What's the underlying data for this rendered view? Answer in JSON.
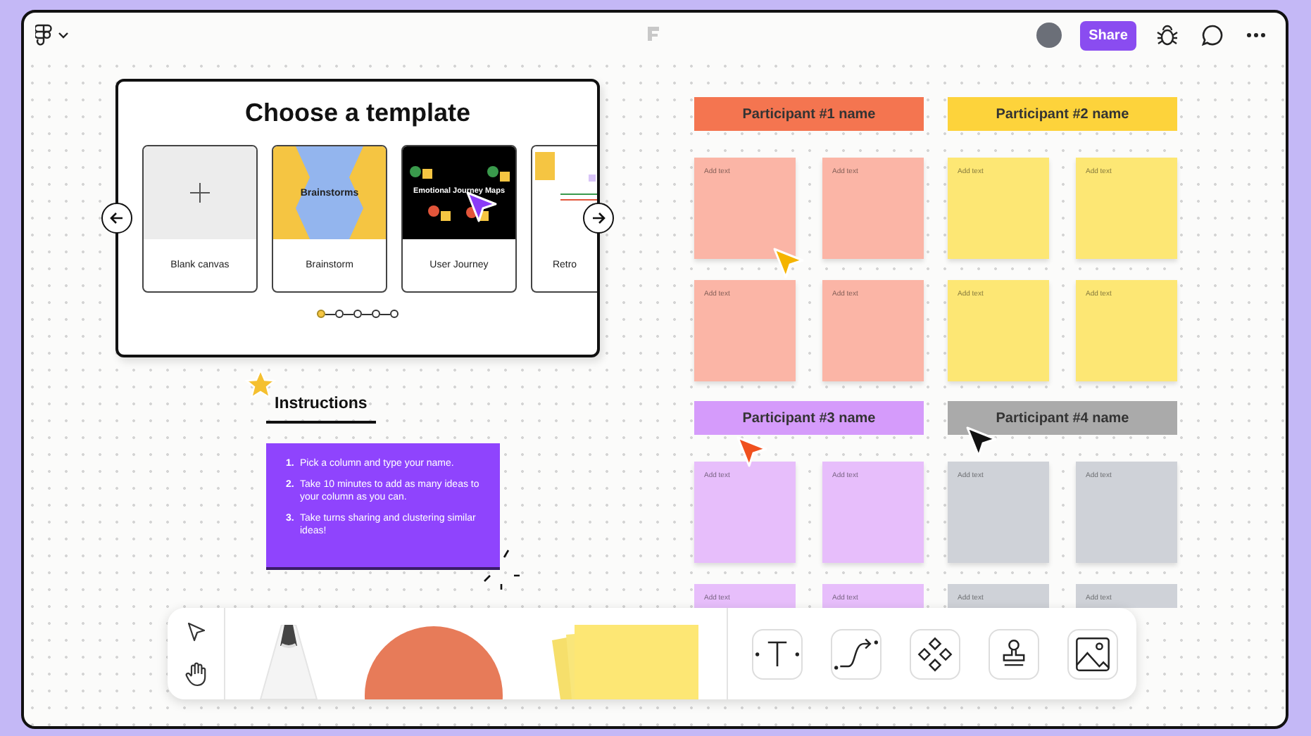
{
  "toolbar": {
    "share_label": "Share"
  },
  "template_picker": {
    "title": "Choose a template",
    "templates": [
      {
        "kind": "blank",
        "label": "Blank canvas"
      },
      {
        "kind": "brainstorm",
        "label": "Brainstorm",
        "preview_text": "Brainstorms"
      },
      {
        "kind": "journey",
        "label": "User Journey",
        "preview_text": "Emotional Journey Maps"
      },
      {
        "kind": "retro",
        "label": "Retro"
      }
    ],
    "pages": [
      {
        "selected": true
      },
      {
        "selected": false
      },
      {
        "selected": false
      },
      {
        "selected": false
      },
      {
        "selected": false
      }
    ]
  },
  "instructions": {
    "heading": "Instructions",
    "steps": [
      {
        "number": "1.",
        "text": "Pick a column and type your name."
      },
      {
        "number": "2.",
        "text": "Take 10 minutes to add as many ideas to your column as you can."
      },
      {
        "number": "3.",
        "text": "Take turns sharing and clustering similar ideas!"
      }
    ]
  },
  "participants": [
    {
      "name": "Participant #1 name",
      "color": "#f47550",
      "notes": [
        {
          "text": "Add text",
          "color": "#fbb5a6"
        },
        {
          "text": "Add text",
          "color": "#fbb5a6"
        },
        {
          "text": "Add text",
          "color": "#fbb5a6"
        },
        {
          "text": "Add text",
          "color": "#fbb5a6"
        }
      ]
    },
    {
      "name": "Participant #2 name",
      "color": "#fdd33b",
      "notes": [
        {
          "text": "Add text",
          "color": "#fde774"
        },
        {
          "text": "Add text",
          "color": "#fde774"
        },
        {
          "text": "Add text",
          "color": "#fde774"
        },
        {
          "text": "Add text",
          "color": "#fde774"
        }
      ]
    },
    {
      "name": "Participant #3 name",
      "color": "#d59bfb",
      "notes": [
        {
          "text": "Add text",
          "color": "#e7befb"
        },
        {
          "text": "Add text",
          "color": "#e7befb"
        },
        {
          "text": "Add text",
          "color": "#e7befb"
        },
        {
          "text": "Add text",
          "color": "#e7befb"
        }
      ]
    },
    {
      "name": "Participant #4 name",
      "color": "#aaaaaa",
      "notes": [
        {
          "text": "Add text",
          "color": "#cfd2d8"
        },
        {
          "text": "Add text",
          "color": "#cfd2d8"
        },
        {
          "text": "Add text",
          "color": "#cfd2d8"
        },
        {
          "text": "Add text",
          "color": "#cfd2d8"
        }
      ]
    }
  ],
  "cursors": [
    {
      "color": "#8b3cf7"
    },
    {
      "color": "#f5b400"
    },
    {
      "color": "#f0501e"
    },
    {
      "color": "#111111"
    }
  ]
}
